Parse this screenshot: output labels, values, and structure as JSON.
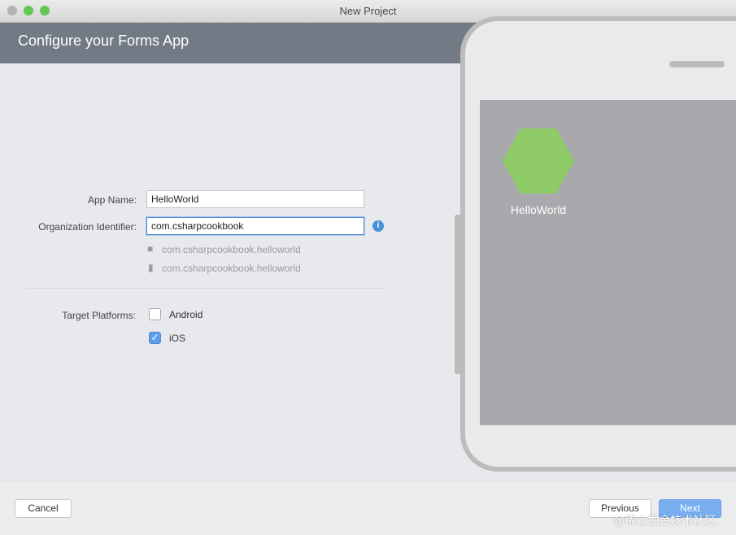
{
  "window": {
    "title": "New Project"
  },
  "header": {
    "title": "Configure your Forms App"
  },
  "form": {
    "app_name_label": "App Name:",
    "app_name_value": "HelloWorld",
    "org_id_label": "Organization Identifier:",
    "org_id_value": "com.csharpcookbook",
    "android_bundle": "com.csharpcookbook.helloworld",
    "ios_bundle": "com.csharpcookbook.helloworld",
    "target_platforms_label": "Target Platforms:",
    "platforms": [
      {
        "label": "Android",
        "checked": false
      },
      {
        "label": "iOS",
        "checked": true
      }
    ]
  },
  "preview": {
    "app_name": "HelloWorld",
    "icon_color": "#8fcc68"
  },
  "footer": {
    "cancel_label": "Cancel",
    "previous_label": "Previous",
    "next_label": "Next"
  },
  "watermark": "@稀土掘金技术社区",
  "colors": {
    "header_bg": "#727a86",
    "accent": "#4a90d9",
    "next_bg": "#78aef0"
  }
}
